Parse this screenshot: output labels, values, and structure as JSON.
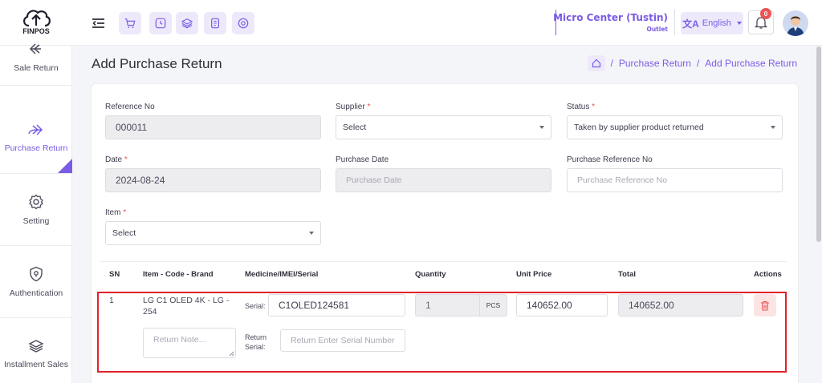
{
  "header": {
    "logo_text": "FINPOS",
    "store_name": "Micro Center (Tustin)",
    "store_type": "Outlet",
    "language": "English",
    "notification_count": "0",
    "quick_icons": [
      "cart-icon",
      "clock-icon",
      "layers-icon",
      "notebook-icon",
      "globe-icon"
    ]
  },
  "sidebar": {
    "items": [
      {
        "label": "Sale Return",
        "icon": "return-arrow-icon"
      },
      {
        "label": "Purchase Return",
        "icon": "forward-arrow-icon"
      },
      {
        "label": "Setting",
        "icon": "gear-icon"
      },
      {
        "label": "Authentication",
        "icon": "shield-icon"
      },
      {
        "label": "Installment Sales",
        "icon": "layers-icon"
      }
    ]
  },
  "page": {
    "title": "Add Purchase Return",
    "breadcrumb": [
      "Purchase Return",
      "Add Purchase Return"
    ]
  },
  "form": {
    "reference_no": {
      "label": "Reference No",
      "value": "000011"
    },
    "supplier": {
      "label": "Supplier",
      "value": "Select"
    },
    "status": {
      "label": "Status",
      "value": "Taken by supplier product returned"
    },
    "date": {
      "label": "Date",
      "value": "2024-08-24"
    },
    "purchase_date": {
      "label": "Purchase Date",
      "placeholder": "Purchase Date"
    },
    "purchase_reference": {
      "label": "Purchase Reference No",
      "placeholder": "Purchase Reference No"
    },
    "item": {
      "label": "Item",
      "value": "Select"
    }
  },
  "table": {
    "columns": [
      "SN",
      "Item - Code - Brand",
      "Medicine/IMEI/Serial",
      "Quantity",
      "Unit Price",
      "Total",
      "Actions"
    ],
    "rows": [
      {
        "sn": "1",
        "item": "LG C1 OLED 4K - LG - 254",
        "serial_label": "Serial:",
        "serial": "C1OLED124581",
        "return_serial_label": "Return Serial:",
        "return_serial_placeholder": "Return Enter Serial Number",
        "return_note_placeholder": "Return Note...",
        "quantity": "1",
        "unit": "PCS",
        "unit_price": "140652.00",
        "total": "140652.00"
      }
    ]
  },
  "colors": {
    "accent": "#7b5ce4",
    "danger": "#ea5455",
    "highlight": "#e2202a"
  }
}
